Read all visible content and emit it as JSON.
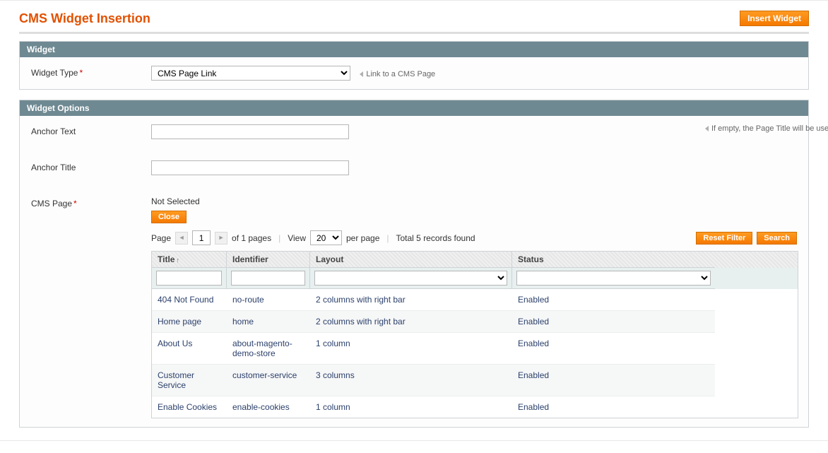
{
  "header": {
    "title": "CMS Widget Insertion",
    "insert_button": "Insert Widget"
  },
  "panels": {
    "widget": {
      "title": "Widget",
      "type_label": "Widget Type",
      "type_selected": "CMS Page Link",
      "type_hint": "Link to a CMS Page"
    },
    "options": {
      "title": "Widget Options",
      "anchor_text_label": "Anchor Text",
      "anchor_text_value": "",
      "anchor_text_hint": "If empty, the Page Title will be used",
      "anchor_title_label": "Anchor Title",
      "anchor_title_value": "",
      "cms_page_label": "CMS Page",
      "cms_page_status": "Not Selected",
      "close_button": "Close"
    }
  },
  "toolbar": {
    "page_label": "Page",
    "page_value": "1",
    "pages_total_text": "of 1 pages",
    "view_label": "View",
    "perpage_value": "20",
    "perpage_suffix": "per page",
    "records_text": "Total 5 records found",
    "reset_filter": "Reset Filter",
    "search": "Search"
  },
  "grid": {
    "columns": {
      "title": "Title",
      "identifier": "Identifier",
      "layout": "Layout",
      "status": "Status"
    },
    "filters": {
      "title": "",
      "identifier": "",
      "layout": "",
      "status": ""
    },
    "rows": [
      {
        "title": "404 Not Found",
        "identifier": "no-route",
        "layout": "2 columns with right bar",
        "status": "Enabled"
      },
      {
        "title": "Home page",
        "identifier": "home",
        "layout": "2 columns with right bar",
        "status": "Enabled"
      },
      {
        "title": "About Us",
        "identifier": "about-magento-demo-store",
        "layout": "1 column",
        "status": "Enabled"
      },
      {
        "title": "Customer Service",
        "identifier": "customer-service",
        "layout": "3 columns",
        "status": "Enabled"
      },
      {
        "title": "Enable Cookies",
        "identifier": "enable-cookies",
        "layout": "1 column",
        "status": "Enabled"
      }
    ]
  }
}
